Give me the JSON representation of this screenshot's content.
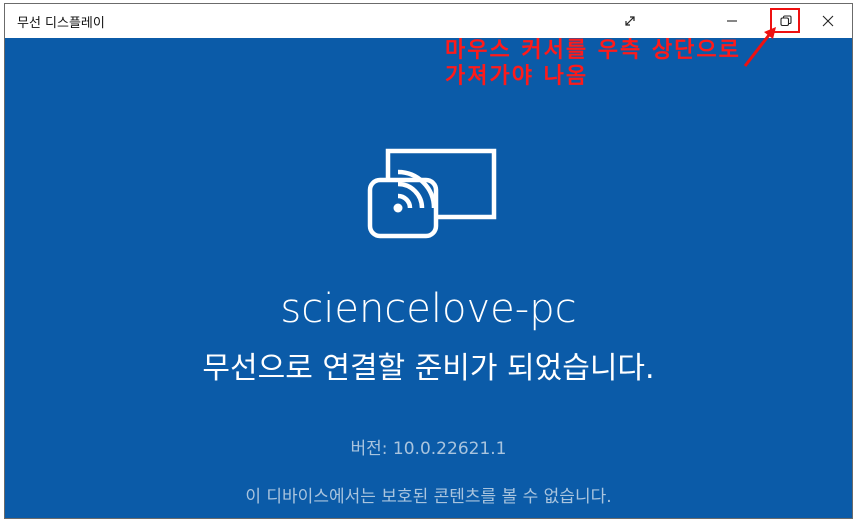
{
  "window": {
    "title": "무선 디스플레이",
    "controls": {
      "fullscreen_icon": "fullscreen-icon",
      "minimize_icon": "minimize-icon",
      "restore_icon": "restore-icon",
      "close_icon": "close-icon"
    }
  },
  "annotation": {
    "text": "마우스 커서를 우측 상단으로\n가져가야 나옴",
    "color": "#ff1a1a"
  },
  "main": {
    "icon": "wireless-cast-icon",
    "device_name": "sciencelove-pc",
    "status": "무선으로 연결할 준비가 되었습니다.",
    "version": "버전: 10.0.22621.1",
    "protection_note": "이 디바이스에서는 보호된 콘텐츠를 볼 수 없습니다."
  },
  "colors": {
    "background": "#0b5ba8",
    "text": "#ffffff",
    "muted_text": "#a9c4de"
  }
}
